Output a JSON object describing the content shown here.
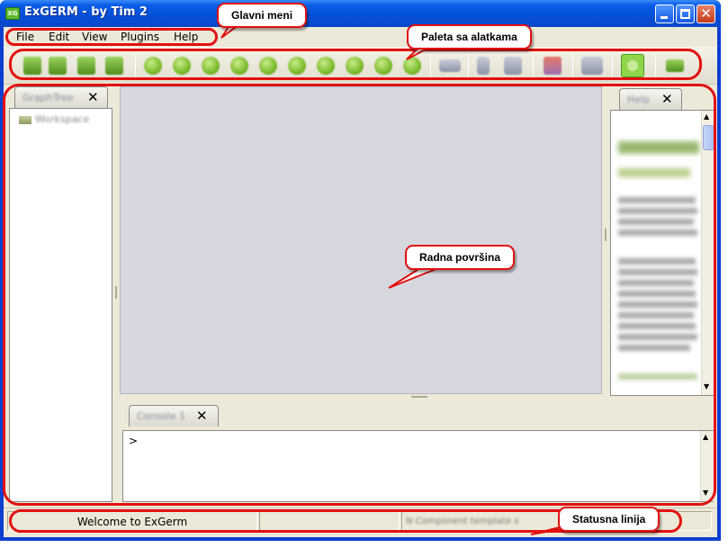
{
  "window": {
    "title": "ExGERM - by Tim 2",
    "app_icon": "XG",
    "close_glyph": "✕"
  },
  "menu": {
    "items": [
      "File",
      "Edit",
      "View",
      "Plugins",
      "Help"
    ]
  },
  "toolbar": {
    "icons": [
      "new-icon",
      "open-icon",
      "save-icon",
      "save-as-icon",
      "node-icon-1",
      "node-icon-2",
      "node-icon-3",
      "node-icon-4",
      "node-icon-5",
      "node-icon-6",
      "node-icon-7",
      "node-icon-8",
      "node-icon-9",
      "node-icon-10",
      "cloud-icon",
      "cut-icon",
      "print-icon",
      "chart-icon",
      "message-icon",
      "run-icon",
      "folder-icon"
    ]
  },
  "left_panel": {
    "tab_label": "GraphTree",
    "close_glyph": "✕",
    "tree_root": "Workspace"
  },
  "right_panel": {
    "tab_label": "Help",
    "close_glyph": "✕",
    "scroll_up": "▲",
    "scroll_down": "▼"
  },
  "console": {
    "tab_label": "Console 1",
    "close_glyph": "✕",
    "prompt": ">",
    "scroll_up": "▲",
    "scroll_down": "▼"
  },
  "status": {
    "message": "Welcome to ExGerm",
    "middle": "",
    "right": "N Component template s"
  },
  "annotations": {
    "main_menu": "Glavni meni",
    "toolbar": "Paleta sa alatkama",
    "workspace": "Radna površina",
    "status_line": "Statusna linija"
  },
  "colors": {
    "annotation": "#e21010",
    "window_frame": "#0c3fd0",
    "client_bg": "#ece9d8",
    "workspace_bg": "#d7d8df"
  }
}
